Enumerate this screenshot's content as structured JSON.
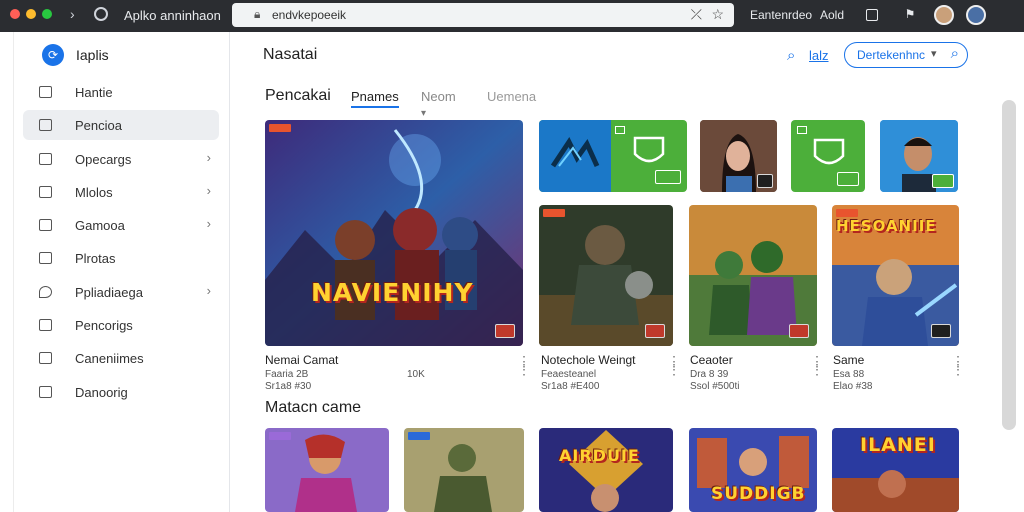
{
  "browser": {
    "tab_title": "Aplko anninhaon",
    "url": "endvkepoeeik",
    "ext_label_1": "Eantenrdeo",
    "ext_label_2": "Aold"
  },
  "sidebar": {
    "brand": "Iaplis",
    "items": [
      {
        "label": "Hantie",
        "icon": "home-icon",
        "arrow": false
      },
      {
        "label": "Pencioa",
        "icon": "folder-icon",
        "arrow": false,
        "active": true
      },
      {
        "label": "Opecargs",
        "icon": "box-icon",
        "arrow": true
      },
      {
        "label": "Mlolos",
        "icon": "grid-icon",
        "arrow": true
      },
      {
        "label": "Gamooa",
        "icon": "tag-icon",
        "arrow": true
      },
      {
        "label": "Plrotas",
        "icon": "photo-icon",
        "arrow": false
      },
      {
        "label": "Ppliadiaega",
        "icon": "location-icon",
        "arrow": true
      },
      {
        "label": "Pencorigs",
        "icon": "edit-icon",
        "arrow": false
      },
      {
        "label": "Caneniimes",
        "icon": "calendar-icon",
        "arrow": false
      },
      {
        "label": "Danoorig",
        "icon": "doc-icon",
        "arrow": false
      }
    ]
  },
  "header": {
    "title": "Nasatai",
    "link": "lalz",
    "search_label": "Dertekenhnc"
  },
  "tabs": [
    "Pencakai",
    "Pnames",
    "Neom",
    "Uemena"
  ],
  "featured": [
    {
      "title": "Nemai Camat",
      "sub": "Faaria 2B",
      "sub2": "Sr1a8 #30",
      "extra": "10K",
      "wordmark": "NAVIENIHY"
    },
    {
      "title": "Notechole Weingt",
      "sub": "Feaesteanel",
      "sub2": "Sr1a8 #E400"
    },
    {
      "title": "Ceaoter",
      "sub": "Dra 8 39",
      "sub2": "Ssol #500ti"
    },
    {
      "title": "Same",
      "sub": "Esa 88",
      "sub2": "Elao #38",
      "wordmark": "HESOANIIE"
    }
  ],
  "section_title": "Matacn came",
  "bottom_wordmarks": [
    "AIRDUIE",
    "SUDDIGB",
    "ILANEI"
  ],
  "colors": {
    "accent": "#1a73e8",
    "chrome": "#2b2d31",
    "green_tile": "#4caf3a"
  }
}
